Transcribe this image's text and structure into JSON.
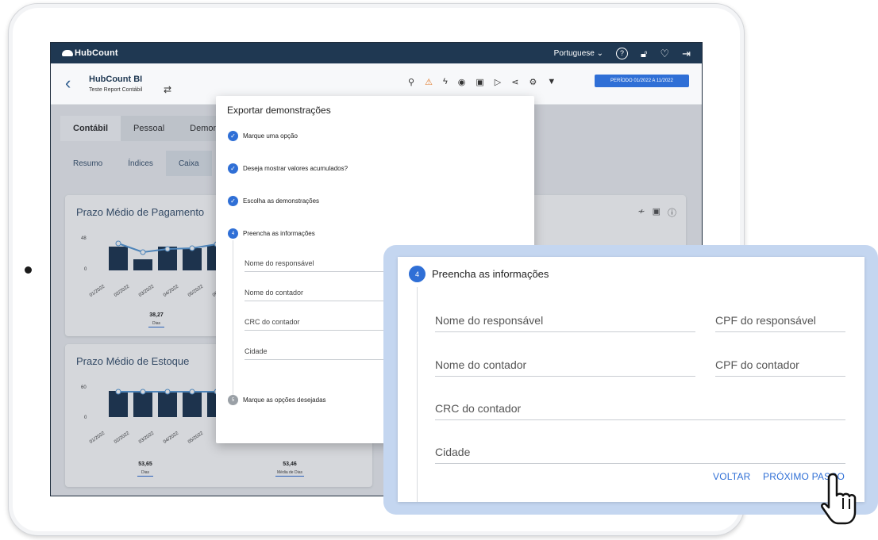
{
  "app": {
    "brand": "HubCount",
    "language": "Portuguese",
    "title": "HubCount BI",
    "subtitle": "Teste Report Contábil",
    "period": "PERÍODO 01/2022 A 11/2022"
  },
  "tabs": [
    "Contábil",
    "Pessoal",
    "Demonst"
  ],
  "subtabs": [
    "Resumo",
    "Índices",
    "Caixa"
  ],
  "cards": {
    "pagamento": {
      "title": "Prazo Médio de Pagamento",
      "y_max": "48",
      "y_min": "0",
      "x_labels": [
        "01/2022",
        "02/2022",
        "03/2022",
        "04/2022",
        "05/2022",
        "06"
      ],
      "kpi_value": "38,27",
      "kpi_label": "Dias"
    },
    "estoque": {
      "title": "Prazo Médio de Estoque",
      "y_max": "60",
      "y_min": "0",
      "x_labels": [
        "01/2022",
        "02/2022",
        "03/2022",
        "04/2022",
        "05/2022"
      ],
      "kpi1_value": "53,65",
      "kpi1_label": "Dias",
      "kpi2_value": "53,46",
      "kpi2_label": "Média de Dias"
    }
  },
  "modal": {
    "title": "Exportar demonstrações",
    "steps": [
      "Marque uma opção",
      "Deseja mostrar valores acumulados?",
      "Escolha as demonstrações",
      "Preencha as informações",
      "Marque as opções desejadas"
    ],
    "step4_num": "4",
    "step5_num": "5",
    "fields": [
      "Nome do responsável",
      "Nome do contador",
      "CRC do contador",
      "Cidade"
    ]
  },
  "zoom": {
    "step_num": "4",
    "title": "Preencha as informações",
    "nome_responsavel": "Nome do responsável",
    "cpf_responsavel": "CPF do responsável",
    "nome_contador": "Nome do contador",
    "cpf_contador": "CPF do contador",
    "crc_contador": "CRC do contador",
    "cidade": "Cidade",
    "back_label": "VOLTAR",
    "next_label": "PRÓXIMO PASSO"
  },
  "colors": {
    "navy": "#1f3852",
    "accent": "#2f6fd6",
    "zoom_bg": "#c4d6f0"
  }
}
